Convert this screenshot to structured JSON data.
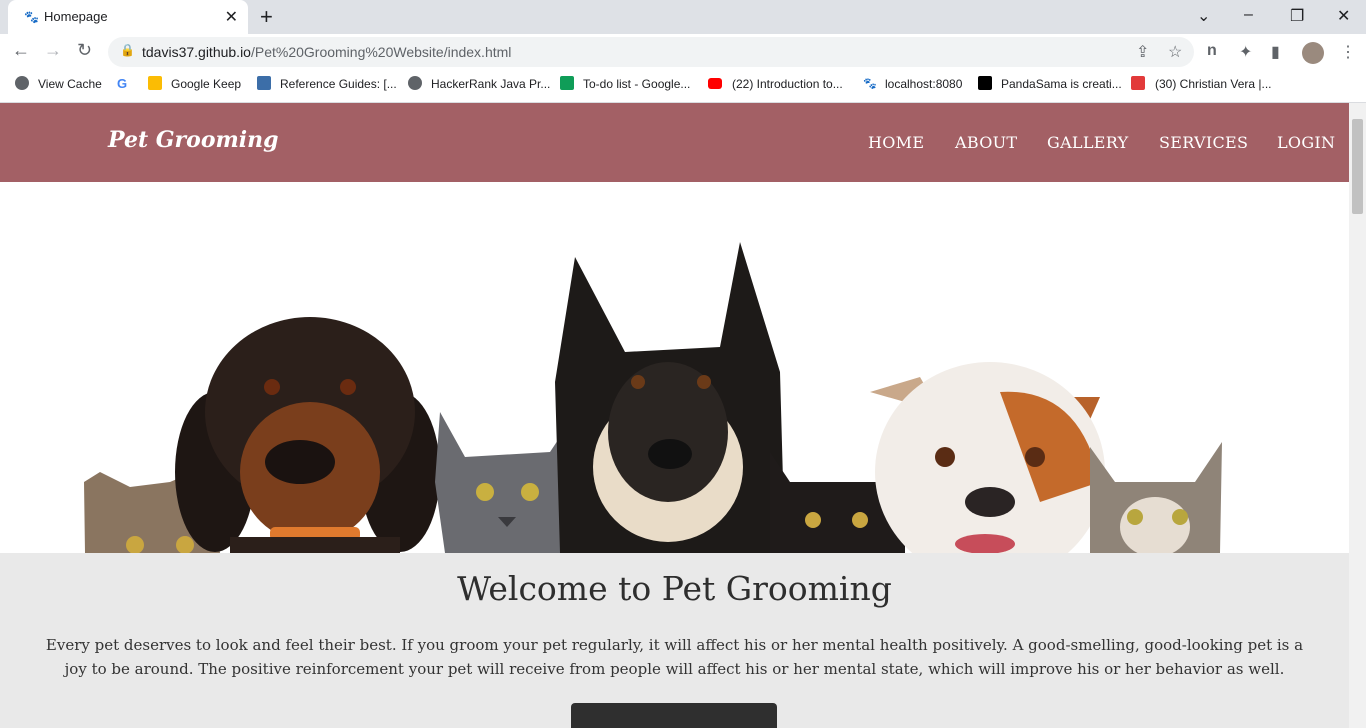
{
  "browser": {
    "tab": {
      "title": "Homepage",
      "favicon": "paw-icon"
    },
    "url": {
      "host": "tdavis37.github.io",
      "path": "/Pet%20Grooming%20Website/index.html"
    },
    "bookmarks": [
      {
        "label": "View Cache",
        "icon": "globe-icon",
        "color": "#5f6368"
      },
      {
        "label": "",
        "icon": "google-icon",
        "color": "#4285f4"
      },
      {
        "label": "Google Keep",
        "icon": "keep-icon",
        "color": "#fbbc04"
      },
      {
        "label": "Reference Guides: [...",
        "icon": "reference-icon",
        "color": "#3c6ea8"
      },
      {
        "label": "HackerRank Java Pr...",
        "icon": "globe-icon",
        "color": "#5f6368"
      },
      {
        "label": "To-do list - Google...",
        "icon": "sheets-icon",
        "color": "#0f9d58"
      },
      {
        "label": "(22) Introduction to...",
        "icon": "youtube-icon",
        "color": "#ff0000"
      },
      {
        "label": "localhost:8080",
        "icon": "paw-icon",
        "color": "#333333"
      },
      {
        "label": "PandaSama is creati...",
        "icon": "patreon-icon",
        "color": "#000000"
      },
      {
        "label": "(30) Christian Vera |...",
        "icon": "app-icon",
        "color": "#e23a3a"
      }
    ]
  },
  "site": {
    "brand": "Pet Grooming",
    "nav": [
      "HOME",
      "ABOUT",
      "GALLERY",
      "SERVICES",
      "LOGIN"
    ],
    "welcome_title": "Welcome to Pet Grooming",
    "welcome_text": "Every pet deserves to look and feel their best. If you groom your pet regularly, it will affect his or her mental health positively. A good-smelling, good-looking pet is a joy to be around. The positive reinforcement your pet will receive from people will affect his or her mental state, which will improve his or her behavior as well.",
    "colors": {
      "header": "#a36065",
      "welcome_bg": "#e9e9e9",
      "button": "#2f2f2f"
    }
  }
}
